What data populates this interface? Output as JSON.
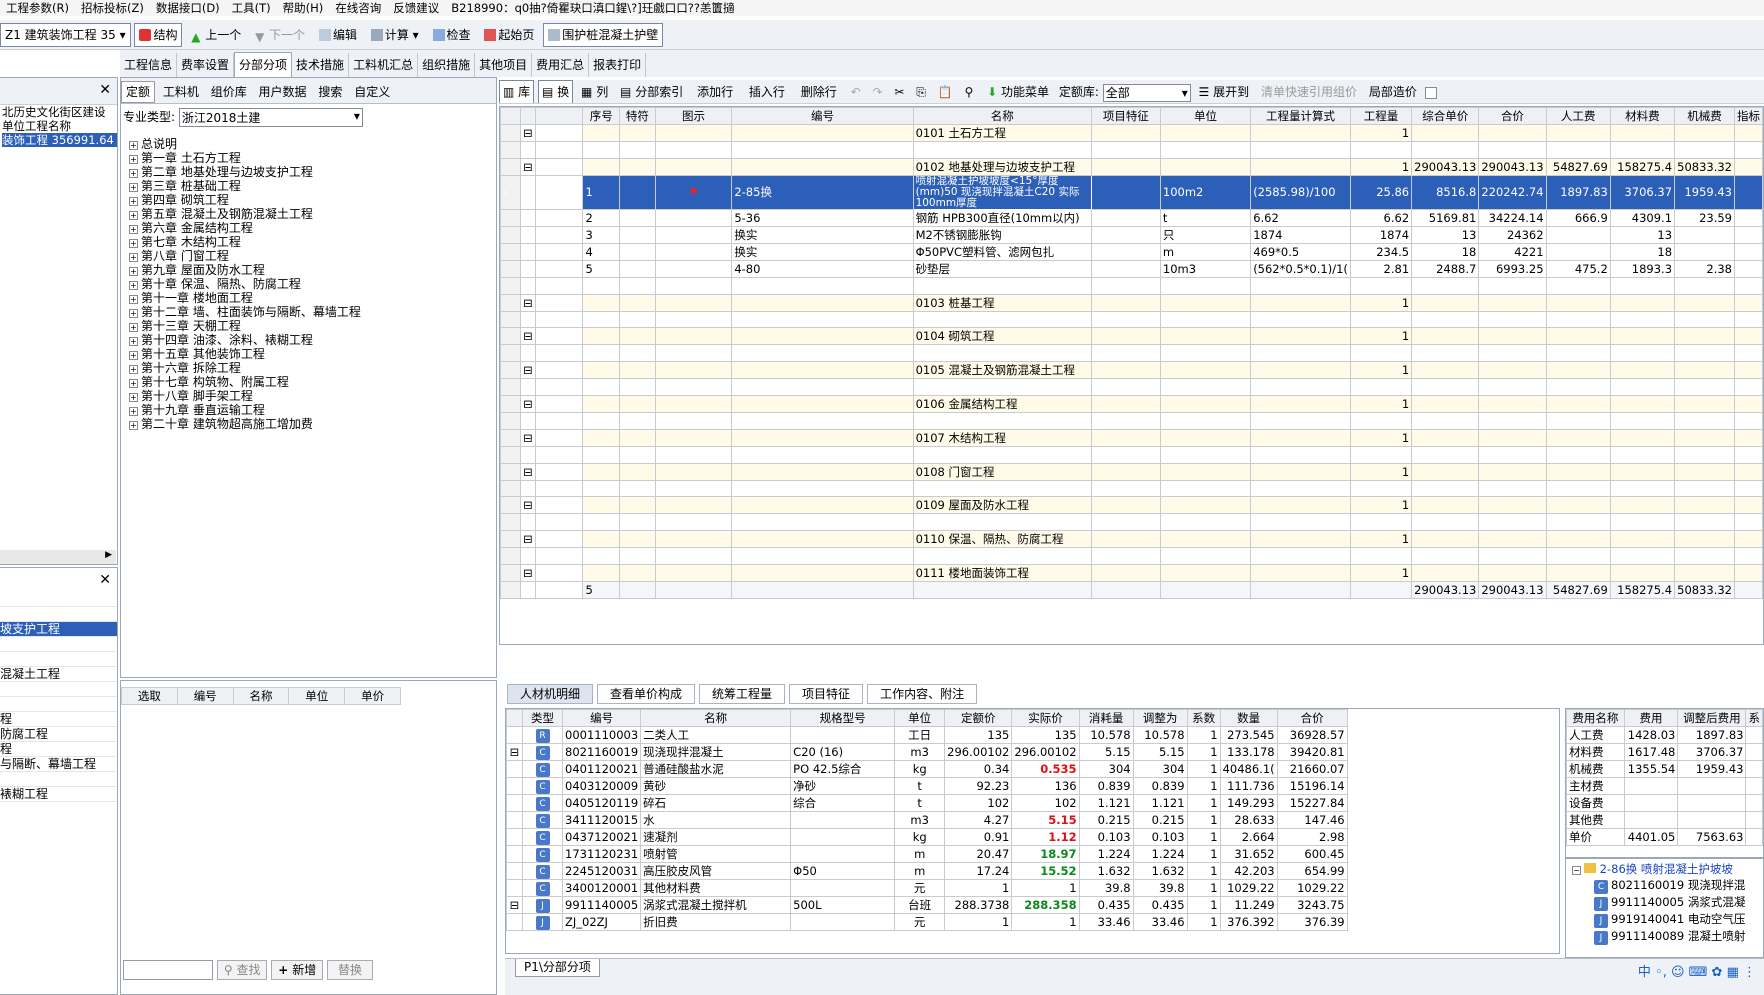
{
  "menubar": [
    "工程参数(R)",
    "招标投标(Z)",
    "数据接口(D)",
    "工具(T)",
    "帮助(H)",
    "在线咨询",
    "反馈建议",
    "B218990：q0抽?倚瞿玦口滇口鍟\\?]玨戲口口??恙籄擿"
  ],
  "toolbar": {
    "project_select": "Z1  建筑装饰工程 35",
    "items": [
      "结构",
      "上一个",
      "下一个",
      "编辑",
      "计算",
      "检查",
      "起始页",
      "围护桩混凝土护壁"
    ]
  },
  "tabs": [
    "工程信息",
    "费率设置",
    "分部分项",
    "技术措施",
    "工料机汇总",
    "组织措施",
    "其他项目",
    "费用汇总",
    "报表打印"
  ],
  "left_top_items": [
    "北历史文化街区建设",
    "单位工程名称",
    "装饰工程 356991.64"
  ],
  "left_panel": {
    "tabs": [
      "定额",
      "工料机",
      "组价库",
      "用户数据",
      "搜索",
      "自定义"
    ],
    "major_label": "专业类型:",
    "major_value": "浙江2018土建",
    "tree": [
      "总说明",
      "第一章 土石方工程",
      "第二章 地基处理与边坡支护工程",
      "第三章 桩基础工程",
      "第四章 砌筑工程",
      "第五章 混凝土及钢筋混凝土工程",
      "第六章 金属结构工程",
      "第七章 木结构工程",
      "第八章 门窗工程",
      "第九章 屋面及防水工程",
      "第十章 保温、隔热、防腐工程",
      "第十一章 楼地面工程",
      "第十二章 墙、柱面装饰与隔断、幕墙工程",
      "第十三章 天棚工程",
      "第十四章 油漆、涂料、裱糊工程",
      "第十五章 其他装饰工程",
      "第十六章 拆除工程",
      "第十七章 构筑物、附属工程",
      "第十八章 脚手架工程",
      "第十九章 垂直运输工程",
      "第二十章 建筑物超高施工增加费"
    ]
  },
  "left_lower_items": [
    "",
    "",
    "坡支护工程",
    "",
    "",
    "混凝土工程",
    "",
    "",
    "程",
    "防腐工程",
    "程",
    "与隔断、幕墙工程",
    "",
    "裱糊工程"
  ],
  "mid_lower": {
    "headers": [
      "选取",
      "编号",
      "名称",
      "单位",
      "单价"
    ],
    "find": "查找",
    "add": "新增",
    "replace": "替换"
  },
  "grid_toolbar": {
    "items": [
      "库",
      "换",
      "列",
      "分部索引",
      "添加行",
      "插入行",
      "删除行",
      "功能菜单",
      "定额库:",
      "展开到",
      "清单快速引用组价",
      "局部造价"
    ],
    "lib_value": "全部"
  },
  "main_table": {
    "headers": [
      "序号",
      "特符",
      "图示",
      "编号",
      "名称",
      "项目特征",
      "单位",
      "工程量计算式",
      "工程量",
      "综合单价",
      "合价",
      "人工费",
      "材料费",
      "机械费",
      "指标"
    ],
    "rows": [
      {
        "t": "sec",
        "cells": [
          "",
          "",
          "",
          "",
          "0101 土石方工程",
          "",
          "",
          "",
          "1",
          "",
          "",
          "",
          "",
          "",
          ""
        ]
      },
      {
        "t": "blank"
      },
      {
        "t": "sec",
        "cells": [
          "",
          "",
          "",
          "",
          "0102 地基处理与边坡支护工程",
          "",
          "",
          "",
          "1",
          "290043.13",
          "290043.13",
          "54827.69",
          "158275.4",
          "50833.32",
          ""
        ]
      },
      {
        "t": "sel",
        "cells": [
          "1",
          "",
          "⚑",
          "2-85换",
          "喷射混凝土护坡坡度<15°厚度(mm)50 现浇现拌混凝土C20 实际100mm厚度",
          "",
          "100m2",
          "(2585.98)/100",
          "25.86",
          "8516.8",
          "220242.74",
          "1897.83",
          "3706.37",
          "1959.43",
          ""
        ]
      },
      {
        "t": "n",
        "cells": [
          "2",
          "",
          "",
          "5-36",
          "钢筋 HPB300直径(10mm以内)",
          "",
          "t",
          "6.62",
          "6.62",
          "5169.81",
          "34224.14",
          "666.9",
          "4309.1",
          "23.59",
          ""
        ]
      },
      {
        "t": "n",
        "cells": [
          "3",
          "",
          "",
          "换实",
          "M2不锈钢膨胀钩",
          "",
          "只",
          "1874",
          "1874",
          "13",
          "24362",
          "",
          "13",
          "",
          ""
        ]
      },
      {
        "t": "n",
        "cells": [
          "4",
          "",
          "",
          "换实",
          "Φ50PVC塑料管、滤网包扎",
          "",
          "m",
          "469*0.5",
          "234.5",
          "18",
          "4221",
          "",
          "18",
          "",
          ""
        ]
      },
      {
        "t": "n",
        "cells": [
          "5",
          "",
          "",
          "4-80",
          "砂垫层",
          "",
          "10m3",
          "(562*0.5*0.1)/1(",
          "2.81",
          "2488.7",
          "6993.25",
          "475.2",
          "1893.3",
          "2.38",
          ""
        ]
      },
      {
        "t": "blank"
      },
      {
        "t": "sec",
        "cells": [
          "",
          "",
          "",
          "",
          "0103 桩基工程",
          "",
          "",
          "",
          "1",
          "",
          "",
          "",
          "",
          "",
          ""
        ]
      },
      {
        "t": "blank"
      },
      {
        "t": "sec",
        "cells": [
          "",
          "",
          "",
          "",
          "0104 砌筑工程",
          "",
          "",
          "",
          "1",
          "",
          "",
          "",
          "",
          "",
          ""
        ]
      },
      {
        "t": "blank"
      },
      {
        "t": "sec",
        "cells": [
          "",
          "",
          "",
          "",
          "0105 混凝土及钢筋混凝土工程",
          "",
          "",
          "",
          "1",
          "",
          "",
          "",
          "",
          "",
          ""
        ]
      },
      {
        "t": "blank"
      },
      {
        "t": "sec",
        "cells": [
          "",
          "",
          "",
          "",
          "0106 金属结构工程",
          "",
          "",
          "",
          "1",
          "",
          "",
          "",
          "",
          "",
          ""
        ]
      },
      {
        "t": "blank"
      },
      {
        "t": "sec",
        "cells": [
          "",
          "",
          "",
          "",
          "0107 木结构工程",
          "",
          "",
          "",
          "1",
          "",
          "",
          "",
          "",
          "",
          ""
        ]
      },
      {
        "t": "blank"
      },
      {
        "t": "sec",
        "cells": [
          "",
          "",
          "",
          "",
          "0108 门窗工程",
          "",
          "",
          "",
          "1",
          "",
          "",
          "",
          "",
          "",
          ""
        ]
      },
      {
        "t": "blank"
      },
      {
        "t": "sec",
        "cells": [
          "",
          "",
          "",
          "",
          "0109 屋面及防水工程",
          "",
          "",
          "",
          "1",
          "",
          "",
          "",
          "",
          "",
          ""
        ]
      },
      {
        "t": "blank"
      },
      {
        "t": "sec",
        "cells": [
          "",
          "",
          "",
          "",
          "0110 保温、隔热、防腐工程",
          "",
          "",
          "",
          "1",
          "",
          "",
          "",
          "",
          "",
          ""
        ]
      },
      {
        "t": "blank"
      },
      {
        "t": "sec",
        "cells": [
          "",
          "",
          "",
          "",
          "0111 楼地面装饰工程",
          "",
          "",
          "",
          "1",
          "",
          "",
          "",
          "",
          "",
          ""
        ]
      }
    ],
    "footer": [
      "5",
      "",
      "",
      "",
      "",
      "",
      "",
      "",
      "",
      "290043.13",
      "290043.13",
      "54827.69",
      "158275.4",
      "50833.32",
      ""
    ]
  },
  "bottom_tabs": [
    "人材机明细",
    "查看单价构成",
    "统筹工程量",
    "项目特征",
    "工作内容、附注"
  ],
  "bottom_table": {
    "headers": [
      "类型",
      "编号",
      "名称",
      "规格型号",
      "单位",
      "定额价",
      "实际价",
      "消耗量",
      "调整为",
      "系数",
      "数量",
      "合价"
    ],
    "rows": [
      [
        "R",
        "0001110003",
        "二类人工",
        "",
        "工日",
        "135",
        "135",
        "10.578",
        "10.578",
        "1",
        "273.545",
        "36928.57"
      ],
      [
        "C",
        "8021160019",
        "现浇现拌混凝土",
        "C20 (16)",
        "m3",
        "296.00102",
        "296.00102",
        "5.15",
        "5.15",
        "1",
        "133.178",
        "39420.81"
      ],
      [
        "C",
        "0401120021",
        "普通硅酸盐水泥",
        "PO 42.5综合",
        "kg",
        "0.34",
        "0.535",
        "304",
        "304",
        "1",
        "40486.1(",
        "21660.07"
      ],
      [
        "C",
        "0403120009",
        "黄砂",
        "净砂",
        "t",
        "92.23",
        "136",
        "0.839",
        "0.839",
        "1",
        "111.736",
        "15196.14"
      ],
      [
        "C",
        "0405120119",
        "碎石",
        "综合",
        "t",
        "102",
        "102",
        "1.121",
        "1.121",
        "1",
        "149.293",
        "15227.84"
      ],
      [
        "C",
        "3411120015",
        "水",
        "",
        "m3",
        "4.27",
        "5.15",
        "0.215",
        "0.215",
        "1",
        "28.633",
        "147.46"
      ],
      [
        "C",
        "0437120021",
        "速凝剂",
        "",
        "kg",
        "0.91",
        "1.12",
        "0.103",
        "0.103",
        "1",
        "2.664",
        "2.98"
      ],
      [
        "C",
        "1731120231",
        "喷射管",
        "",
        "m",
        "20.47",
        "18.97",
        "1.224",
        "1.224",
        "1",
        "31.652",
        "600.45"
      ],
      [
        "C",
        "2245120031",
        "高压胶皮风管",
        "Φ50",
        "m",
        "17.24",
        "15.52",
        "1.632",
        "1.632",
        "1",
        "42.203",
        "654.99"
      ],
      [
        "C",
        "3400120001",
        "其他材料费",
        "",
        "元",
        "1",
        "1",
        "39.8",
        "39.8",
        "1",
        "1029.22",
        "1029.22"
      ],
      [
        "J",
        "9911140005",
        "涡浆式混凝土搅拌机",
        "500L",
        "台班",
        "288.3738",
        "288.358",
        "0.435",
        "0.435",
        "1",
        "11.249",
        "3243.75"
      ],
      [
        "J",
        "ZJ_02ZJ",
        "折旧费",
        "",
        "元",
        "1",
        "1",
        "33.46",
        "33.46",
        "1",
        "376.392",
        "376.39"
      ]
    ],
    "actual_style": [
      "",
      "",
      "red",
      "",
      "",
      "red",
      "red",
      "green",
      "green",
      "",
      "green",
      ""
    ]
  },
  "fee_table": {
    "headers": [
      "费用名称",
      "费用",
      "调整后费用",
      "系"
    ],
    "rows": [
      [
        "人工费",
        "1428.03",
        "1897.83"
      ],
      [
        "材料费",
        "1617.48",
        "3706.37"
      ],
      [
        "机械费",
        "1355.54",
        "1959.43"
      ],
      [
        "主材费",
        "",
        ""
      ],
      [
        "设备费",
        "",
        ""
      ],
      [
        "其他费",
        "",
        ""
      ],
      [
        "单价",
        "4401.05",
        "7563.63"
      ]
    ]
  },
  "right_tree": {
    "root": "2-86换 喷射混凝土护坡坡",
    "items": [
      "8021160019 现浇现拌混",
      "9911140005 涡浆式混凝",
      "9919140041 电动空气压",
      "9911140089 混凝土喷射"
    ]
  },
  "sheet_tab": "P1\\分部分项",
  "tray": "中 ◦, ☺ ⌨ ✿ ▦ ⋮"
}
